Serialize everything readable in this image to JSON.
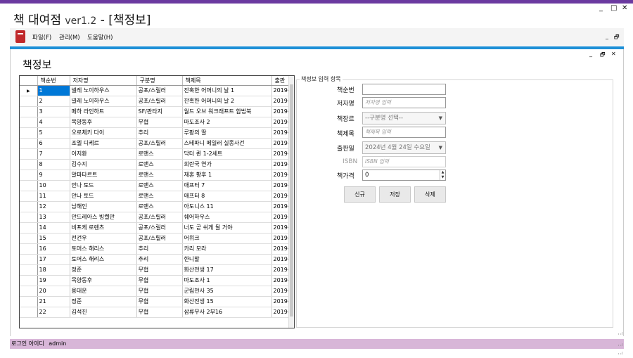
{
  "app": {
    "title": "책 대여점",
    "version": "ver1.2",
    "doc": "- [책정보]"
  },
  "window_controls": {
    "min": "_",
    "max": "□",
    "close": "✕"
  },
  "menu": {
    "items": [
      "파일(F)",
      "관리(M)",
      "도움말(H)"
    ],
    "mdi_min": "_",
    "mdi_restore": "🗗"
  },
  "child_controls": {
    "min": "_",
    "restore": "🗗",
    "close": "✕"
  },
  "form_title": "책정보",
  "grid": {
    "columns": [
      "책순번",
      "저자명",
      "구분명",
      "책제목",
      "출판"
    ],
    "rows": [
      [
        "1",
        "넬레 노이하우스",
        "공포/스릴러",
        "잔혹한 어머니의 날 1",
        "2019-"
      ],
      [
        "2",
        "넬레 노이하우스",
        "공포/스릴러",
        "잔혹한 어머니의 날 2",
        "2019-"
      ],
      [
        "3",
        "메하 라인하트",
        "SF/판타지",
        "월드 오브 워크래프트 합법북",
        "2019-"
      ],
      [
        "4",
        "목양동후",
        "무협",
        "마도조사 2",
        "2019-"
      ],
      [
        "5",
        "오로체키 다이",
        "추리",
        "루팡의 딸",
        "2019-"
      ],
      [
        "6",
        "조엘 디케르",
        "공포/스릴러",
        "스테파니 메일러 실종사건",
        "2019-"
      ],
      [
        "7",
        "이지환",
        "로맨스",
        "닥터 퀸 1-2세트",
        "2019-"
      ],
      [
        "8",
        "김수지",
        "로맨스",
        "희란국 연가",
        "2019-"
      ],
      [
        "9",
        "알파타르트",
        "로맨스",
        "재혼 황후 1",
        "2019-"
      ],
      [
        "10",
        "안나 토드",
        "로맨스",
        "애프터 7",
        "2019-"
      ],
      [
        "11",
        "안나 토드",
        "로맨스",
        "애프터 8",
        "2019-"
      ],
      [
        "12",
        "남해인",
        "로맨스",
        "아도니스 11",
        "2019-"
      ],
      [
        "13",
        "안드레아스 빙켈만",
        "공포/스릴러",
        "쉐어하우스",
        "2019-"
      ],
      [
        "14",
        "비프케 로렌츠",
        "공포/스릴러",
        "너도 곧 쉬게 될 거야",
        "2019-"
      ],
      [
        "15",
        "전건우",
        "공포/스릴러",
        "어위크",
        "2019-"
      ],
      [
        "16",
        "토머스 해리스",
        "추리",
        "카리 모라",
        "2019-"
      ],
      [
        "17",
        "토머스 해리스",
        "추리",
        "한니발",
        "2019-"
      ],
      [
        "18",
        "정준",
        "무협",
        "화산전생 17",
        "2019-"
      ],
      [
        "19",
        "목양동후",
        "무협",
        "마도조사 1",
        "2019-"
      ],
      [
        "20",
        "용대운",
        "무협",
        "군림천사 35",
        "2019-"
      ],
      [
        "21",
        "정준",
        "무협",
        "화산전생 15",
        "2019-"
      ],
      [
        "22",
        "김석진",
        "무협",
        "삼류무사 2부16",
        "2019-"
      ]
    ],
    "selected_indicator": "▶"
  },
  "form": {
    "group_label": "책정보 입력 항목",
    "fields": {
      "seq": {
        "label": "책순번",
        "value": ""
      },
      "author": {
        "label": "저자명",
        "placeholder": "저자명 입력"
      },
      "genre": {
        "label": "책장르",
        "value": "--구분명 선택--"
      },
      "title": {
        "label": "책제목",
        "placeholder": "책제목 입력"
      },
      "date": {
        "label": "출판일",
        "value": "2024년 4월 24일 수요일"
      },
      "isbn": {
        "label": "ISBN",
        "placeholder": "ISBN 입력"
      },
      "price": {
        "label": "책가격",
        "value": "0"
      }
    },
    "buttons": {
      "new": "신규",
      "save": "저장",
      "delete": "삭제"
    }
  },
  "status": {
    "label": "로그인 아이디",
    "user": "admin"
  }
}
